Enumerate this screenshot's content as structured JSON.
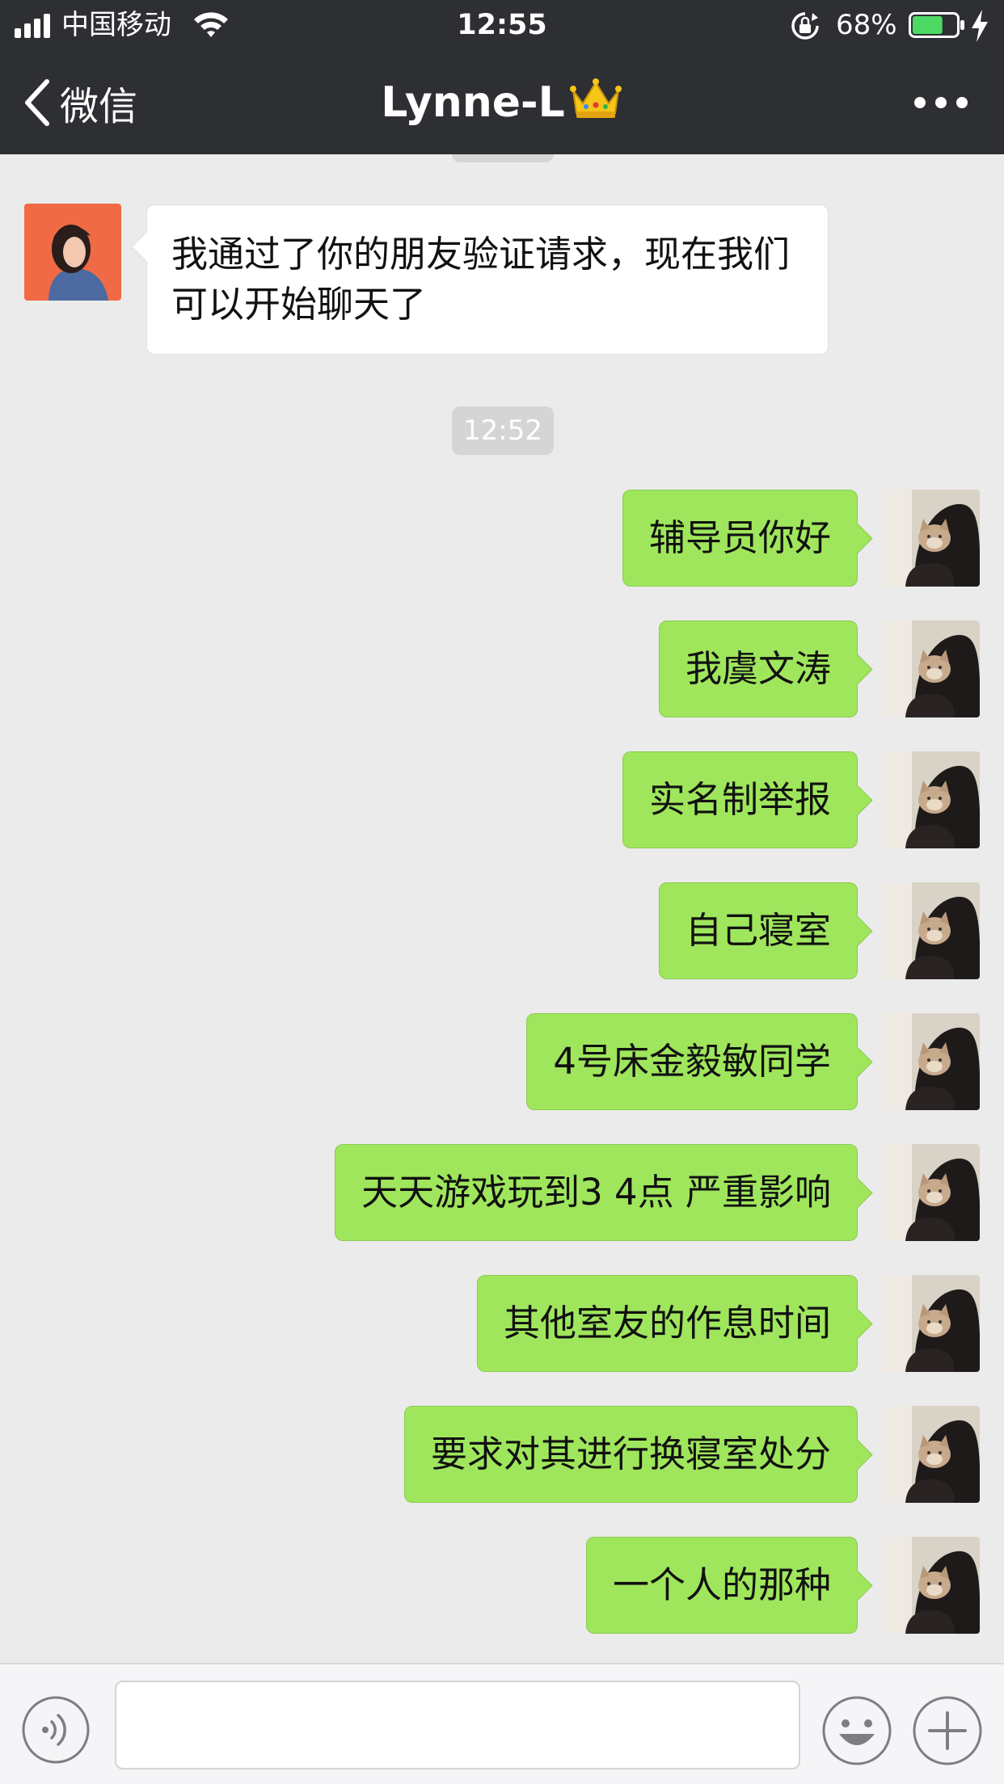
{
  "status_bar": {
    "carrier": "中国移动",
    "time": "12:55",
    "battery_percent": "68%",
    "battery_level": 0.68,
    "icons": [
      "signal-icon",
      "wifi-icon",
      "rotation-lock-icon",
      "battery-icon",
      "charging-icon"
    ]
  },
  "nav": {
    "back_label": "微信",
    "title": "Lynne-L",
    "title_emoji": "crown-icon",
    "more_icon": "more-dots-icon"
  },
  "chat": {
    "timestamp": "12:52",
    "incoming": {
      "text": "我通过了你的朋友验证请求，现在我们可以开始聊天了"
    },
    "outgoing": [
      {
        "text": "辅导员你好"
      },
      {
        "text": "我虞文涛"
      },
      {
        "text": "实名制举报"
      },
      {
        "text": "自己寝室"
      },
      {
        "text": "4号床金毅敏同学"
      },
      {
        "text": "天天游戏玩到3 4点  严重影响"
      },
      {
        "text": "其他室友的作息时间"
      },
      {
        "text": "要求对其进行换寝室处分"
      },
      {
        "text": "一个人的那种"
      }
    ]
  },
  "input_bar": {
    "icons": [
      "voice-icon",
      "emoji-icon",
      "plus-icon"
    ],
    "message_value": ""
  },
  "colors": {
    "nav_bg": "#2e2f33",
    "chat_bg": "#ebebeb",
    "outgoing_bubble": "#9fe65c",
    "incoming_bubble": "#ffffff",
    "timestamp_chip": "#d5d5d5"
  }
}
